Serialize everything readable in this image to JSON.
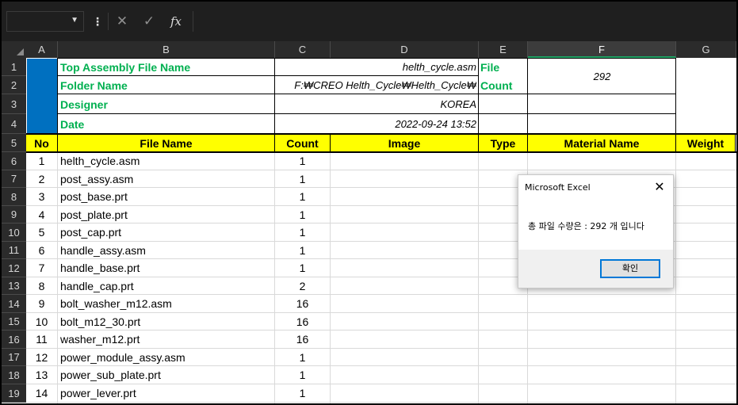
{
  "formula_bar": {
    "name_box": "",
    "cancel_icon": "✕",
    "enter_icon": "✓",
    "fx_label": "fx",
    "formula": ""
  },
  "columns": [
    "A",
    "B",
    "C",
    "D",
    "E",
    "F",
    "G"
  ],
  "rows": [
    "1",
    "2",
    "3",
    "4",
    "5",
    "6",
    "7",
    "8",
    "9",
    "10",
    "11",
    "12",
    "13",
    "14",
    "15",
    "16",
    "17",
    "18",
    "19"
  ],
  "header_block": {
    "top_assembly_label": "Top Assembly File Name",
    "top_assembly_value": "helth_cycle.asm",
    "folder_label": "Folder Name",
    "folder_value": "F:₩CREO Helth_Cycle₩Helth_Cycle₩",
    "designer_label": "Designer",
    "designer_value": "KOREA",
    "date_label": "Date",
    "date_value": "2022-09-24 13:52",
    "file_label": "File",
    "count_label": "Count",
    "file_count_value": "292"
  },
  "table_headers": {
    "no": "No",
    "file_name": "File Name",
    "count": "Count",
    "image": "Image",
    "type": "Type",
    "material_name": "Material Name",
    "weight": "Weight"
  },
  "table_rows": [
    {
      "no": "1",
      "file_name": "helth_cycle.asm",
      "count": "1"
    },
    {
      "no": "2",
      "file_name": "post_assy.asm",
      "count": "1"
    },
    {
      "no": "3",
      "file_name": "post_base.prt",
      "count": "1"
    },
    {
      "no": "4",
      "file_name": "post_plate.prt",
      "count": "1"
    },
    {
      "no": "5",
      "file_name": "post_cap.prt",
      "count": "1"
    },
    {
      "no": "6",
      "file_name": "handle_assy.asm",
      "count": "1"
    },
    {
      "no": "7",
      "file_name": "handle_base.prt",
      "count": "1"
    },
    {
      "no": "8",
      "file_name": "handle_cap.prt",
      "count": "2"
    },
    {
      "no": "9",
      "file_name": "bolt_washer_m12.asm",
      "count": "16"
    },
    {
      "no": "10",
      "file_name": "bolt_m12_30.prt",
      "count": "16"
    },
    {
      "no": "11",
      "file_name": "washer_m12.prt",
      "count": "16"
    },
    {
      "no": "12",
      "file_name": "power_module_assy.asm",
      "count": "1"
    },
    {
      "no": "13",
      "file_name": "power_sub_plate.prt",
      "count": "1"
    },
    {
      "no": "14",
      "file_name": "power_lever.prt",
      "count": "1"
    }
  ],
  "dialog": {
    "title": "Microsoft Excel",
    "message": "총 파일 수량은 : 292 개 입니다",
    "ok_label": "확인",
    "close_icon": "✕"
  }
}
